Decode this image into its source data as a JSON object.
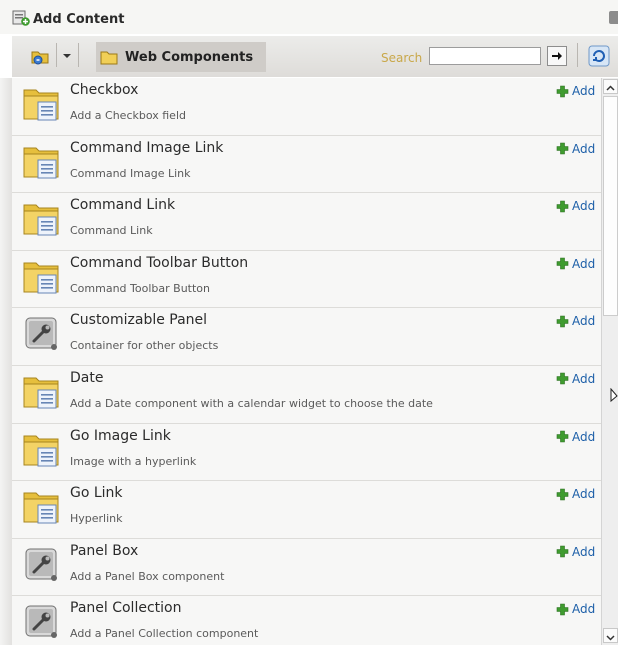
{
  "window": {
    "title": "Add Content"
  },
  "toolbar": {
    "folder_label": "Web Components",
    "search_label": "Search",
    "search_value": ""
  },
  "components": [
    {
      "name": "Checkbox",
      "description": "Add a Checkbox field",
      "icon": "folder-document-icon",
      "add_label": "Add"
    },
    {
      "name": "Command Image Link",
      "description": "Command Image Link",
      "icon": "folder-document-icon",
      "add_label": "Add"
    },
    {
      "name": "Command Link",
      "description": "Command Link",
      "icon": "folder-document-icon",
      "add_label": "Add"
    },
    {
      "name": "Command Toolbar Button",
      "description": "Command Toolbar Button",
      "icon": "folder-document-icon",
      "add_label": "Add"
    },
    {
      "name": "Customizable Panel",
      "description": "Container for other objects",
      "icon": "wrench-panel-icon",
      "add_label": "Add"
    },
    {
      "name": "Date",
      "description": "Add a Date component with a calendar widget to choose the date",
      "icon": "folder-document-icon",
      "add_label": "Add"
    },
    {
      "name": "Go Image Link",
      "description": "Image with a hyperlink",
      "icon": "folder-document-icon",
      "add_label": "Add"
    },
    {
      "name": "Go Link",
      "description": "Hyperlink",
      "icon": "folder-document-icon",
      "add_label": "Add"
    },
    {
      "name": "Panel Box",
      "description": "Add a Panel Box component",
      "icon": "wrench-panel-icon",
      "add_label": "Add"
    },
    {
      "name": "Panel Collection",
      "description": "Add a Panel Collection component",
      "icon": "wrench-panel-icon",
      "add_label": "Add"
    }
  ],
  "colors": {
    "link": "#1d5fa8",
    "add_icon": "#3f9b2f",
    "folder": "#e6bf3d",
    "toolbar_bg": "#dedcd9",
    "list_bg": "#f7f7f6"
  }
}
